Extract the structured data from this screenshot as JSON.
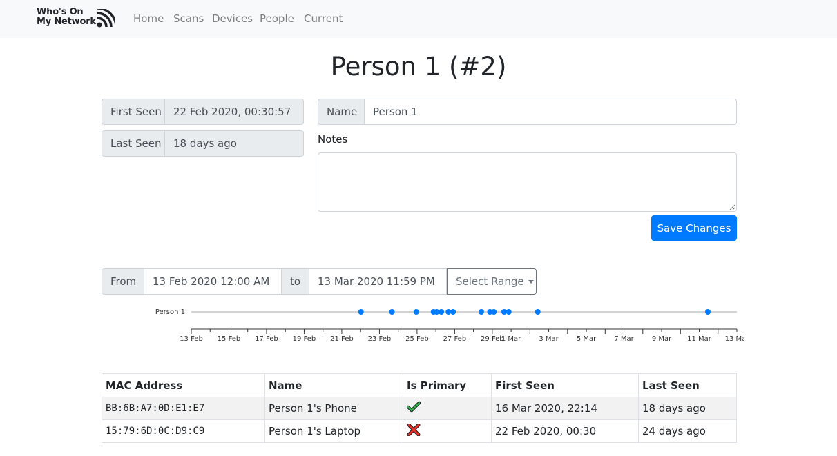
{
  "navbar": {
    "brand_line1": "Who's On",
    "brand_line2": "My Network",
    "brand_icon": "wifi-signal-icon",
    "links": [
      "Home",
      "Scans",
      "Devices",
      "People",
      "Current"
    ]
  },
  "page": {
    "title": "Person 1 (#2)"
  },
  "seen": {
    "first_label": "First Seen",
    "first_value": "22 Feb 2020, 00:30:57",
    "last_label": "Last Seen",
    "last_value": "18 days ago"
  },
  "form": {
    "name_label": "Name",
    "name_value": "Person 1",
    "notes_label": "Notes",
    "notes_value": "",
    "save_label": "Save Changes"
  },
  "range": {
    "from_label": "From",
    "from_value": "13 Feb 2020 12:00 AM",
    "to_label": "to",
    "to_value": "13 Mar 2020 11:59 PM",
    "select_label": "Select Range"
  },
  "timeline": {
    "row_label": "Person 1",
    "start_day": "2020-02-13",
    "end_day": "2020-03-13",
    "ticks": [
      "13 Feb",
      "15 Feb",
      "17 Feb",
      "19 Feb",
      "21 Feb",
      "23 Feb",
      "25 Feb",
      "27 Feb",
      "29 Feb",
      "1 Mar",
      "3 Mar",
      "5 Mar",
      "7 Mar",
      "9 Mar",
      "11 Mar",
      "13 Mar"
    ],
    "events": [
      "2020-02-22T00:30",
      "2020-02-23T16:00",
      "2020-02-24T23:00",
      "2020-02-25T21:00",
      "2020-02-26T01:00",
      "2020-02-26T07:00",
      "2020-02-26T16:00",
      "2020-02-26T22:00",
      "2020-02-28T10:00",
      "2020-02-28T21:00",
      "2020-02-29T02:00",
      "2020-02-29T15:00",
      "2020-02-29T21:00",
      "2020-03-02T10:00",
      "2020-03-11T11:00"
    ],
    "accent": "#007bff"
  },
  "devices": {
    "headers": [
      "MAC Address",
      "Name",
      "Is Primary",
      "First Seen",
      "Last Seen"
    ],
    "rows": [
      {
        "mac": "BB:6B:A7:0D:E1:E7",
        "name": "Person 1's Phone",
        "primary": "check-icon",
        "first_seen": "16 Mar 2020, 22:14",
        "last_seen": "18 days ago"
      },
      {
        "mac": "15:79:6D:0C:D9:C9",
        "name": "Person 1's Laptop",
        "primary": "cross-icon",
        "first_seen": "22 Feb 2020, 00:30",
        "last_seen": "24 days ago"
      }
    ]
  }
}
